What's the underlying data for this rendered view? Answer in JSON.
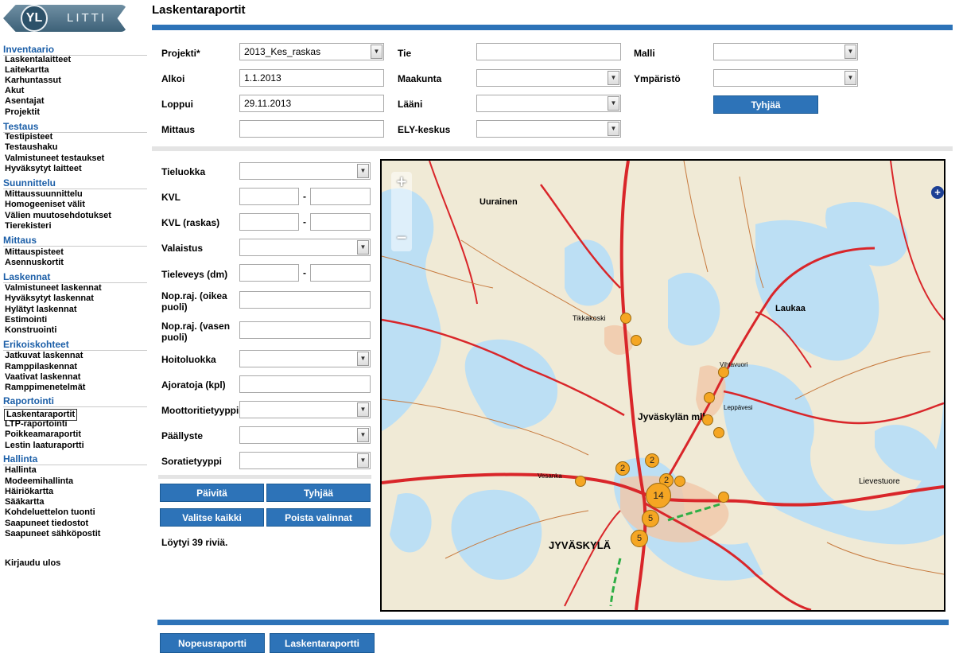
{
  "logo": {
    "initials": "YL",
    "word": "LITTI"
  },
  "page_title": "Laskentaraportit",
  "nav": {
    "sections": [
      {
        "title": "Inventaario",
        "items": [
          "Laskentalaitteet",
          "Laitekartta",
          "Karhuntassut",
          "Akut",
          "Asentajat",
          "Projektit"
        ]
      },
      {
        "title": "Testaus",
        "items": [
          "Testipisteet",
          "Testaushaku",
          "Valmistuneet testaukset",
          "Hyväksytyt laitteet"
        ]
      },
      {
        "title": "Suunnittelu",
        "items": [
          "Mittaussuunnittelu",
          "Homogeeniset välit",
          "Välien muutosehdotukset",
          "Tierekisteri"
        ]
      },
      {
        "title": "Mittaus",
        "items": [
          "Mittauspisteet",
          "Asennuskortit"
        ]
      },
      {
        "title": "Laskennat",
        "items": [
          "Valmistuneet laskennat",
          "Hyväksytyt laskennat",
          "Hylätyt laskennat",
          "Estimointi",
          "Konstruointi"
        ]
      },
      {
        "title": "Erikoiskohteet",
        "items": [
          "Jatkuvat laskennat",
          "Ramppilaskennat",
          "Vaativat laskennat",
          "Ramppimenetelmät"
        ]
      },
      {
        "title": "Raportointi",
        "items": [
          "Laskentaraportit",
          "LTP-raportointi",
          "Poikkeamaraportit",
          "Lestin laaturaportti"
        ]
      },
      {
        "title": "Hallinta",
        "items": [
          "Hallinta",
          "Modeemihallinta",
          "Häiriökartta",
          "Sääkartta",
          "Kohdeluettelon tuonti",
          "Saapuneet tiedostot",
          "Saapuneet sähköpostit"
        ]
      }
    ],
    "active": "Laskentaraportit",
    "logout": "Kirjaudu ulos"
  },
  "filters_top": {
    "projekti": {
      "label": "Projekti*",
      "value": "2013_Kes_raskas"
    },
    "alkoi": {
      "label": "Alkoi",
      "value": "1.1.2013"
    },
    "loppui": {
      "label": "Loppui",
      "value": "29.11.2013"
    },
    "mittaus": {
      "label": "Mittaus",
      "value": ""
    },
    "tie": {
      "label": "Tie",
      "value": ""
    },
    "maakunta": {
      "label": "Maakunta",
      "value": ""
    },
    "laani": {
      "label": "Lääni",
      "value": ""
    },
    "ely": {
      "label": "ELY-keskus",
      "value": ""
    },
    "malli": {
      "label": "Malli",
      "value": ""
    },
    "ymparisto": {
      "label": "Ympäristö",
      "value": ""
    },
    "clear_button": "Tyhjää"
  },
  "filters_left": {
    "tieluokka": "Tieluokka",
    "kvl": "KVL",
    "kvl_raskas": "KVL (raskas)",
    "valaistus": "Valaistus",
    "tieleveys": "Tieleveys (dm)",
    "nopraj_oikea": "Nop.raj. (oikea puoli)",
    "nopraj_vasen": "Nop.raj. (vasen puoli)",
    "hoitoluokka": "Hoitoluokka",
    "ajoratoja": "Ajoratoja (kpl)",
    "moottoritietyyppi": "Moottoritietyyppi",
    "paallyste": "Päällyste",
    "soratietyyppi": "Soratietyyppi",
    "range_sep": "-"
  },
  "actions": {
    "paivita": "Päivitä",
    "tyhjaa": "Tyhjää",
    "valitse_kaikki": "Valitse kaikki",
    "poista_valinnat": "Poista valinnat",
    "result_text": "Löytyi 39 riviä."
  },
  "map": {
    "zoom_in": "+",
    "zoom_out": "−",
    "corner_icon": "+",
    "place_labels": [
      "Uurainen",
      "Laukaa",
      "Tikkakoski",
      "Jyväskylän mlk",
      "JYVÄSKYLÄ",
      "Lievestuore",
      "Vihtavuori",
      "Leppävesi",
      "Vesanka"
    ],
    "clusters": [
      "2",
      "2",
      "2",
      "14",
      "5",
      "5"
    ],
    "colors": {
      "marker": "#f5a623",
      "road": "#d9262a",
      "water": "#bcdff4",
      "land": "#f2ecd9"
    }
  },
  "bottom": {
    "nopeusraportti": "Nopeusraportti",
    "laskentaraportti": "Laskentaraportti"
  }
}
